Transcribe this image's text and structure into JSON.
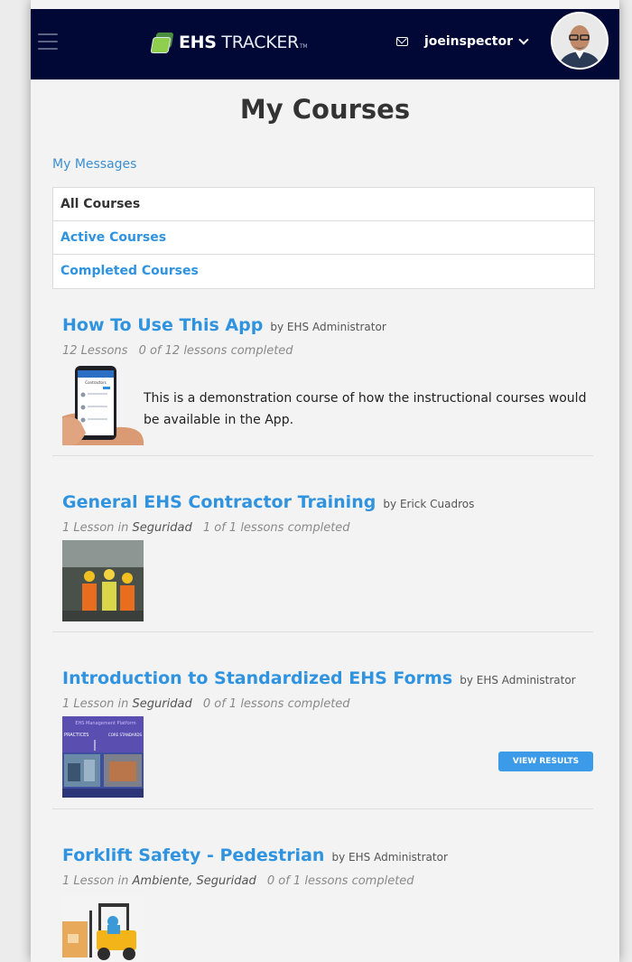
{
  "header": {
    "logo_bold": "EHS",
    "logo_light": "TRACKER",
    "logo_tm": "TM",
    "username": "joeinspector"
  },
  "page": {
    "title": "My Courses",
    "messages_link": "My Messages"
  },
  "filters": [
    {
      "label": "All Courses",
      "active": true
    },
    {
      "label": "Active Courses",
      "active": false
    },
    {
      "label": "Completed Courses",
      "active": false
    }
  ],
  "courses": [
    {
      "title": "How To Use This App",
      "by": "by EHS Administrator",
      "lessons": "12 Lessons",
      "in": "",
      "category": "",
      "completed": "0 of 12 lessons completed",
      "description": "This is a demonstration course of how the instructional courses would be available in the App."
    },
    {
      "title": "General EHS Contractor Training",
      "by": "by Erick Cuadros",
      "lessons": "1 Lesson",
      "in": "in",
      "category": "Seguridad",
      "completed": "1 of 1 lessons completed"
    },
    {
      "title": "Introduction to Standardized EHS Forms",
      "by": "by EHS Administrator",
      "lessons": "1 Lesson",
      "in": "in",
      "category": "Seguridad",
      "completed": "0 of 1 lessons completed",
      "button": "VIEW RESULTS"
    },
    {
      "title": "Forklift Safety - Pedestrian",
      "by": "by EHS Administrator",
      "lessons": "1 Lesson",
      "in": "in",
      "category": "Ambiente, Seguridad",
      "completed": "0 of 1 lessons completed"
    }
  ],
  "thumb_text": {
    "app_screen": "Contractors",
    "forms_banner": "EHS Management Platform",
    "forms_left": "PRACTICES",
    "forms_right": "CORE STANDARDS"
  },
  "colors": {
    "header_bg": "#020836",
    "link_blue": "#2f93e0",
    "button_blue": "#3c9be8"
  }
}
